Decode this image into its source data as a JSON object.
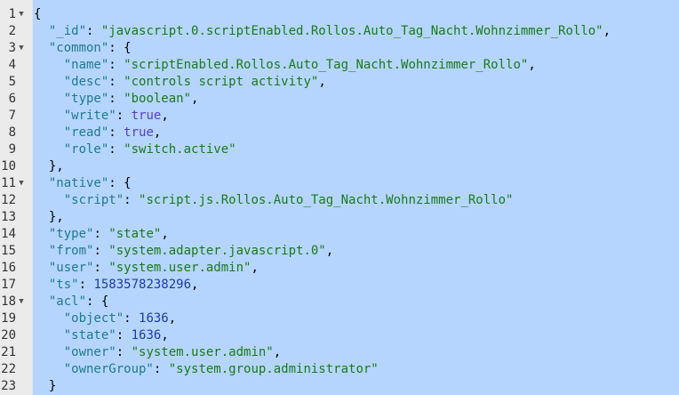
{
  "editor": {
    "lines": [
      {
        "n": "1",
        "fold": "▼",
        "tokens": [
          {
            "t": "{",
            "c": "pun"
          }
        ]
      },
      {
        "n": "2",
        "fold": "",
        "tokens": [
          {
            "t": "  ",
            "c": "pun"
          },
          {
            "t": "\"_id\"",
            "c": "key"
          },
          {
            "t": ": ",
            "c": "pun"
          },
          {
            "t": "\"javascript.0.scriptEnabled.Rollos.Auto_Tag_Nacht.Wohnzimmer_Rollo\"",
            "c": "str"
          },
          {
            "t": ",",
            "c": "pun"
          }
        ]
      },
      {
        "n": "3",
        "fold": "▼",
        "tokens": [
          {
            "t": "  ",
            "c": "pun"
          },
          {
            "t": "\"common\"",
            "c": "key"
          },
          {
            "t": ": {",
            "c": "pun"
          }
        ]
      },
      {
        "n": "4",
        "fold": "",
        "tokens": [
          {
            "t": "    ",
            "c": "pun"
          },
          {
            "t": "\"name\"",
            "c": "key"
          },
          {
            "t": ": ",
            "c": "pun"
          },
          {
            "t": "\"scriptEnabled.Rollos.Auto_Tag_Nacht.Wohnzimmer_Rollo\"",
            "c": "str"
          },
          {
            "t": ",",
            "c": "pun"
          }
        ]
      },
      {
        "n": "5",
        "fold": "",
        "tokens": [
          {
            "t": "    ",
            "c": "pun"
          },
          {
            "t": "\"desc\"",
            "c": "key"
          },
          {
            "t": ": ",
            "c": "pun"
          },
          {
            "t": "\"controls script activity\"",
            "c": "str"
          },
          {
            "t": ",",
            "c": "pun"
          }
        ]
      },
      {
        "n": "6",
        "fold": "",
        "tokens": [
          {
            "t": "    ",
            "c": "pun"
          },
          {
            "t": "\"type\"",
            "c": "key"
          },
          {
            "t": ": ",
            "c": "pun"
          },
          {
            "t": "\"boolean\"",
            "c": "str"
          },
          {
            "t": ",",
            "c": "pun"
          }
        ]
      },
      {
        "n": "7",
        "fold": "",
        "tokens": [
          {
            "t": "    ",
            "c": "pun"
          },
          {
            "t": "\"write\"",
            "c": "key"
          },
          {
            "t": ": ",
            "c": "pun"
          },
          {
            "t": "true",
            "c": "kw"
          },
          {
            "t": ",",
            "c": "pun"
          }
        ]
      },
      {
        "n": "8",
        "fold": "",
        "tokens": [
          {
            "t": "    ",
            "c": "pun"
          },
          {
            "t": "\"read\"",
            "c": "key"
          },
          {
            "t": ": ",
            "c": "pun"
          },
          {
            "t": "true",
            "c": "kw"
          },
          {
            "t": ",",
            "c": "pun"
          }
        ]
      },
      {
        "n": "9",
        "fold": "",
        "tokens": [
          {
            "t": "    ",
            "c": "pun"
          },
          {
            "t": "\"role\"",
            "c": "key"
          },
          {
            "t": ": ",
            "c": "pun"
          },
          {
            "t": "\"switch.active\"",
            "c": "str"
          }
        ]
      },
      {
        "n": "10",
        "fold": "",
        "tokens": [
          {
            "t": "  },",
            "c": "pun"
          }
        ]
      },
      {
        "n": "11",
        "fold": "▼",
        "tokens": [
          {
            "t": "  ",
            "c": "pun"
          },
          {
            "t": "\"native\"",
            "c": "key"
          },
          {
            "t": ": {",
            "c": "pun"
          }
        ]
      },
      {
        "n": "12",
        "fold": "",
        "tokens": [
          {
            "t": "    ",
            "c": "pun"
          },
          {
            "t": "\"script\"",
            "c": "key"
          },
          {
            "t": ": ",
            "c": "pun"
          },
          {
            "t": "\"script.js.Rollos.Auto_Tag_Nacht.Wohnzimmer_Rollo\"",
            "c": "str"
          }
        ]
      },
      {
        "n": "13",
        "fold": "",
        "tokens": [
          {
            "t": "  },",
            "c": "pun"
          }
        ]
      },
      {
        "n": "14",
        "fold": "",
        "tokens": [
          {
            "t": "  ",
            "c": "pun"
          },
          {
            "t": "\"type\"",
            "c": "key"
          },
          {
            "t": ": ",
            "c": "pun"
          },
          {
            "t": "\"state\"",
            "c": "str"
          },
          {
            "t": ",",
            "c": "pun"
          }
        ]
      },
      {
        "n": "15",
        "fold": "",
        "tokens": [
          {
            "t": "  ",
            "c": "pun"
          },
          {
            "t": "\"from\"",
            "c": "key"
          },
          {
            "t": ": ",
            "c": "pun"
          },
          {
            "t": "\"system.adapter.javascript.0\"",
            "c": "str"
          },
          {
            "t": ",",
            "c": "pun"
          }
        ]
      },
      {
        "n": "16",
        "fold": "",
        "tokens": [
          {
            "t": "  ",
            "c": "pun"
          },
          {
            "t": "\"user\"",
            "c": "key"
          },
          {
            "t": ": ",
            "c": "pun"
          },
          {
            "t": "\"system.user.admin\"",
            "c": "str"
          },
          {
            "t": ",",
            "c": "pun"
          }
        ]
      },
      {
        "n": "17",
        "fold": "",
        "tokens": [
          {
            "t": "  ",
            "c": "pun"
          },
          {
            "t": "\"ts\"",
            "c": "key"
          },
          {
            "t": ": ",
            "c": "pun"
          },
          {
            "t": "1583578238296",
            "c": "num"
          },
          {
            "t": ",",
            "c": "pun"
          }
        ]
      },
      {
        "n": "18",
        "fold": "▼",
        "tokens": [
          {
            "t": "  ",
            "c": "pun"
          },
          {
            "t": "\"acl\"",
            "c": "key"
          },
          {
            "t": ": {",
            "c": "pun"
          }
        ]
      },
      {
        "n": "19",
        "fold": "",
        "tokens": [
          {
            "t": "    ",
            "c": "pun"
          },
          {
            "t": "\"object\"",
            "c": "key"
          },
          {
            "t": ": ",
            "c": "pun"
          },
          {
            "t": "1636",
            "c": "num"
          },
          {
            "t": ",",
            "c": "pun"
          }
        ]
      },
      {
        "n": "20",
        "fold": "",
        "tokens": [
          {
            "t": "    ",
            "c": "pun"
          },
          {
            "t": "\"state\"",
            "c": "key"
          },
          {
            "t": ": ",
            "c": "pun"
          },
          {
            "t": "1636",
            "c": "num"
          },
          {
            "t": ",",
            "c": "pun"
          }
        ]
      },
      {
        "n": "21",
        "fold": "",
        "tokens": [
          {
            "t": "    ",
            "c": "pun"
          },
          {
            "t": "\"owner\"",
            "c": "key"
          },
          {
            "t": ": ",
            "c": "pun"
          },
          {
            "t": "\"system.user.admin\"",
            "c": "str"
          },
          {
            "t": ",",
            "c": "pun"
          }
        ]
      },
      {
        "n": "22",
        "fold": "",
        "tokens": [
          {
            "t": "    ",
            "c": "pun"
          },
          {
            "t": "\"ownerGroup\"",
            "c": "key"
          },
          {
            "t": ": ",
            "c": "pun"
          },
          {
            "t": "\"system.group.administrator\"",
            "c": "str"
          }
        ]
      },
      {
        "n": "23",
        "fold": "",
        "tokens": [
          {
            "t": "  }",
            "c": "pun"
          }
        ]
      }
    ]
  },
  "colors": {
    "selection": "#b5d5ff",
    "gutter": "#ebebeb",
    "key": "#1f7a8c",
    "string": "#1a7a1a",
    "keyword": "#5b3cc4",
    "number": "#1c3aa9"
  }
}
